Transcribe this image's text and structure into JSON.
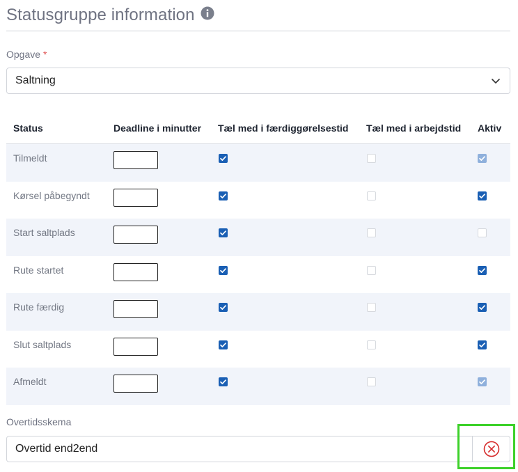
{
  "header": {
    "title": "Statusgruppe information",
    "info_icon": "info-icon"
  },
  "task": {
    "label": "Opgave",
    "required_marker": "*",
    "value": "Saltning"
  },
  "table": {
    "columns": [
      "Status",
      "Deadline i minutter",
      "Tæl med i færdiggørelsestid",
      "Tæl med i arbejdstid",
      "Aktiv"
    ],
    "rows": [
      {
        "status": "Tilmeldt",
        "deadline": "",
        "completion_time": "checked",
        "work_time": "unchecked-disabled",
        "active": "checked-disabled"
      },
      {
        "status": "Kørsel påbegyndt",
        "deadline": "",
        "completion_time": "checked",
        "work_time": "unchecked-disabled",
        "active": "checked"
      },
      {
        "status": "Start saltplads",
        "deadline": "",
        "completion_time": "checked",
        "work_time": "unchecked-disabled",
        "active": "unchecked"
      },
      {
        "status": "Rute startet",
        "deadline": "",
        "completion_time": "checked",
        "work_time": "unchecked-disabled",
        "active": "checked"
      },
      {
        "status": "Rute færdig",
        "deadline": "",
        "completion_time": "checked",
        "work_time": "unchecked-disabled",
        "active": "checked"
      },
      {
        "status": "Slut saltplads",
        "deadline": "",
        "completion_time": "checked",
        "work_time": "unchecked-disabled",
        "active": "checked"
      },
      {
        "status": "Afmeldt",
        "deadline": "",
        "completion_time": "checked",
        "work_time": "unchecked-disabled",
        "active": "checked-disabled"
      }
    ]
  },
  "overtime": {
    "label": "Overtidsskema",
    "value": "Overtid end2end",
    "clear_icon": "clear-circle-x-icon"
  },
  "colors": {
    "accent": "#1a5fb4",
    "highlight": "#3dd12a",
    "clear": "#d62b2b"
  }
}
